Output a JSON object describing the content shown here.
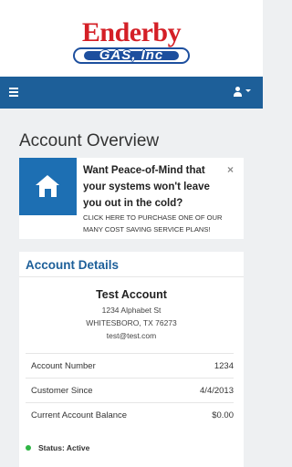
{
  "logo": {
    "main": "Enderby",
    "sub": "GAS, Inc"
  },
  "nav": {
    "menu_icon": "hamburger-icon",
    "user_icon": "user-icon"
  },
  "page": {
    "title": "Account Overview"
  },
  "promo": {
    "icon": "home-icon",
    "title": "Want Peace-of-Mind that your systems won't leave you out in the cold?",
    "close": "×",
    "subtitle": "Click here to purchase one of our many cost saving service plans!"
  },
  "account": {
    "header": "Account Details",
    "name": "Test Account",
    "address1": "1234 Alphabet St",
    "address2": "WHITESBORO, TX 76273",
    "email": "test@test.com",
    "rows": [
      {
        "label": "Account Number",
        "value": "1234"
      },
      {
        "label": "Customer Since",
        "value": "4/4/2013"
      },
      {
        "label": "Current Account Balance",
        "value": "$0.00"
      }
    ],
    "status": "Status: Active",
    "status_color": "#2fb545"
  },
  "colors": {
    "navbar": "#1d5f99",
    "accent": "#1d6fb3",
    "brand_red": "#d41f26"
  }
}
